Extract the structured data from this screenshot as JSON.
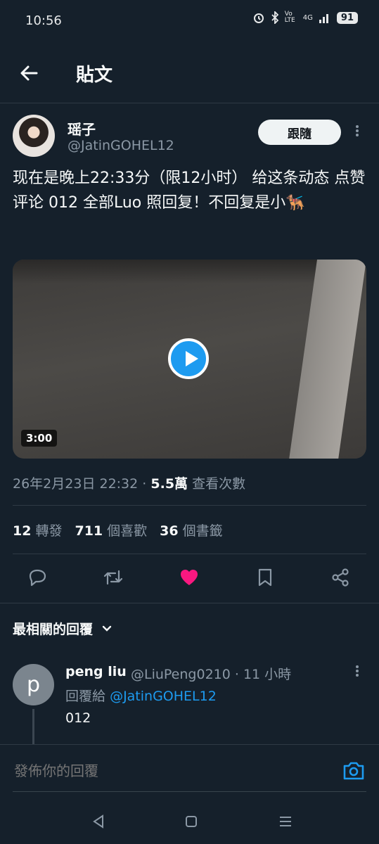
{
  "status_bar": {
    "time": "10:56",
    "volte": "Vo LTE",
    "network": "4G",
    "battery": "91"
  },
  "header": {
    "title": "貼文"
  },
  "post": {
    "author_name": "瑶子",
    "author_handle": "@JatinGOHEL12",
    "follow_label": "跟隨",
    "text": "现在是晚上22:33分（限12小时） 给这条动态 点赞评论 012 全部Luo 照回复！不回复是小🐕‍🦺",
    "video_duration": "3:00",
    "timestamp": "26年2月23日 22:32",
    "meta_separator": "·",
    "views_count": "5.5萬",
    "views_label": "查看次數"
  },
  "stats": {
    "reposts_count": "12",
    "reposts_label": "轉發",
    "likes_count": "711",
    "likes_label": "個喜歡",
    "bookmarks_count": "36",
    "bookmarks_label": "個書籤"
  },
  "actions": [
    "reply-icon",
    "retweet-icon",
    "like-icon-filled",
    "bookmark-icon",
    "share-icon"
  ],
  "replies_header": {
    "label": "最相關的回覆"
  },
  "reply": {
    "avatar_letter": "p",
    "name": "peng liu",
    "handle_time": "@LiuPeng0210 · 11 小時",
    "replying_to_label": "回覆給",
    "replying_to_handle": "@JatinGOHEL12",
    "text": "012"
  },
  "reply_bar": {
    "placeholder": "發佈你的回覆"
  },
  "colors": {
    "background": "#15202b",
    "accent": "#1d9bf0",
    "like": "#f91880"
  }
}
